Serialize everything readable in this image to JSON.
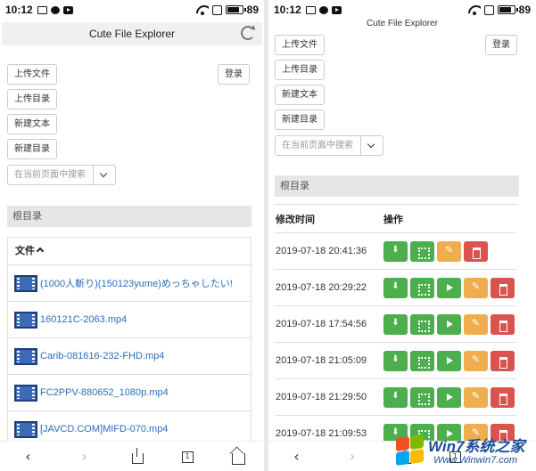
{
  "status": {
    "time": "10:12",
    "battery": "89"
  },
  "app": {
    "title": "Cute File Explorer"
  },
  "actions": {
    "upload_file": "上传文件",
    "upload_dir": "上传目录",
    "new_text": "新建文本",
    "new_dir": "新建目录",
    "login": "登录"
  },
  "search": {
    "placeholder": "在当前页面中搜索"
  },
  "breadcrumb": {
    "root": "根目录"
  },
  "file_list": {
    "header": "文件",
    "items": [
      "(1000人斬り)(150123yume)めっちゃしたい!",
      "160121C-2063.mp4",
      "Carib-081616-232-FHD.mp4",
      "FC2PPV-880652_1080p.mp4",
      "[JAVCD.COM]MIFD-070.mp4"
    ]
  },
  "detail_table": {
    "col_modified": "修改时间",
    "col_actions": "操作",
    "rows": [
      {
        "modified": "2019-07-18 20:41:36",
        "playable": false
      },
      {
        "modified": "2019-07-18 20:29:22",
        "playable": true
      },
      {
        "modified": "2019-07-18 17:54:56",
        "playable": true
      },
      {
        "modified": "2019-07-18 21:05:09",
        "playable": true
      },
      {
        "modified": "2019-07-18 21:29:50",
        "playable": true
      },
      {
        "modified": "2019-07-18 21:09:53",
        "playable": true
      }
    ]
  },
  "nav": {
    "tab_count": "1"
  },
  "watermark": {
    "brand": "Win7系统之家",
    "url": "Www.Winwin7.com"
  },
  "colors": {
    "green": "#4cae4c",
    "orange": "#f0ad4e",
    "red": "#d9534f",
    "link": "#2a6ebb"
  }
}
